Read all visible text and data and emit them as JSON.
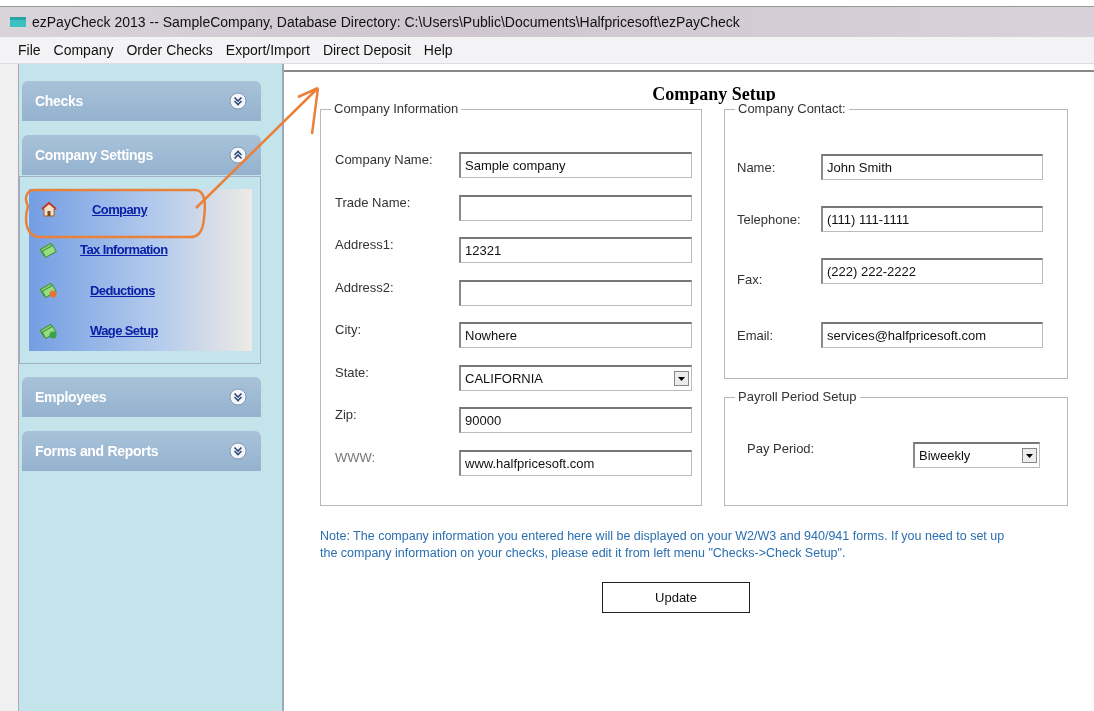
{
  "window": {
    "title": "ezPayCheck 2013 -- SampleCompany, Database Directory: C:\\Users\\Public\\Documents\\Halfpricesoft\\ezPayCheck"
  },
  "menu": [
    "File",
    "Company",
    "Order Checks",
    "Export/Import",
    "Direct Deposit",
    "Help"
  ],
  "sidebar": {
    "sections": [
      {
        "label": "Checks",
        "expanded": false
      },
      {
        "label": "Company Settings",
        "expanded": true,
        "items": [
          {
            "label": "Company"
          },
          {
            "label": "Tax Information"
          },
          {
            "label": "Deductions"
          },
          {
            "label": "Wage Setup"
          }
        ]
      },
      {
        "label": "Employees",
        "expanded": false
      },
      {
        "label": "Forms and Reports",
        "expanded": false
      }
    ]
  },
  "page_title": "Company Setup",
  "company_information": {
    "title": "Company Information",
    "fields": [
      {
        "label": "Company Name:",
        "kind": "text",
        "value": "Sample company"
      },
      {
        "label": "Trade Name:",
        "kind": "text"
      },
      {
        "label": "Address1:",
        "kind": "text",
        "value": "12321"
      },
      {
        "label": "Address2:",
        "kind": "text"
      },
      {
        "label": "City:",
        "kind": "text",
        "value": "Nowhere"
      },
      {
        "label": "State:",
        "kind": "select",
        "value": "CALIFORNIA"
      },
      {
        "label": "Zip:",
        "kind": "text",
        "value": "90000"
      },
      {
        "label": "WWW:",
        "kind": "text",
        "value": "www.halfpricesoft.com"
      }
    ]
  },
  "company_contact": {
    "title": "Company Contact:",
    "fields": [
      {
        "label": "Name:",
        "kind": "text",
        "value": "John Smith"
      },
      {
        "label": "Telephone:",
        "kind": "text",
        "value": "(111) 111-1111"
      },
      {
        "label": "Fax:",
        "kind": "text",
        "value": "(222) 222-2222"
      },
      {
        "label": "Email:",
        "kind": "text",
        "value": "services@halfpricesoft.com"
      }
    ]
  },
  "payroll_period": {
    "title": "Payroll Period Setup",
    "fields": [
      {
        "label": "Pay Period:",
        "kind": "select",
        "value": "Biweekly"
      }
    ]
  },
  "note": "Note: The company information you entered here will be displayed on your W2/W3 and 940/941 forms.  If you need to set up the company information on your checks, please edit it from left menu \"Checks->Check Setup\".",
  "buttons": [
    "Update"
  ]
}
